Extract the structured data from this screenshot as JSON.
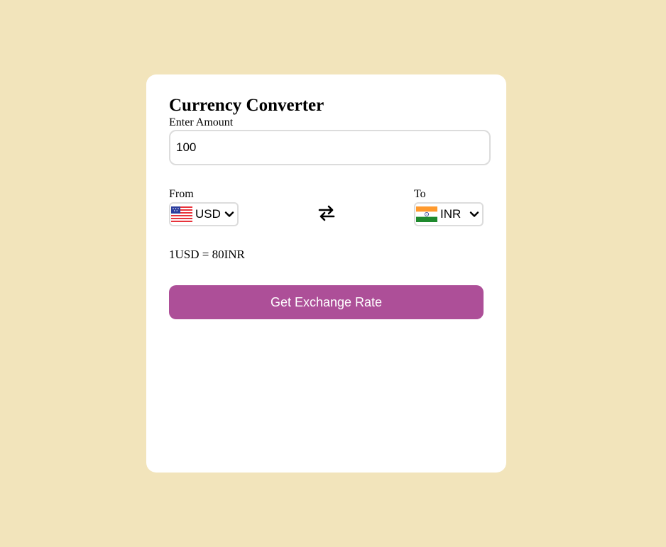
{
  "app": {
    "title": "Currency Converter"
  },
  "amount": {
    "label": "Enter Amount",
    "value": "100"
  },
  "from": {
    "label": "From",
    "currency": "USD",
    "flag_icon": "us-flag-icon"
  },
  "to": {
    "label": "To",
    "currency": "INR",
    "flag_icon": "india-flag-icon"
  },
  "swap": {
    "icon": "swap-arrows-icon"
  },
  "rate": {
    "text": "1USD = 80INR"
  },
  "button": {
    "label": "Get Exchange Rate"
  },
  "colors": {
    "background": "#f2e4bb",
    "card": "#ffffff",
    "accent": "#ad4f98",
    "border": "#dcdcdc"
  }
}
